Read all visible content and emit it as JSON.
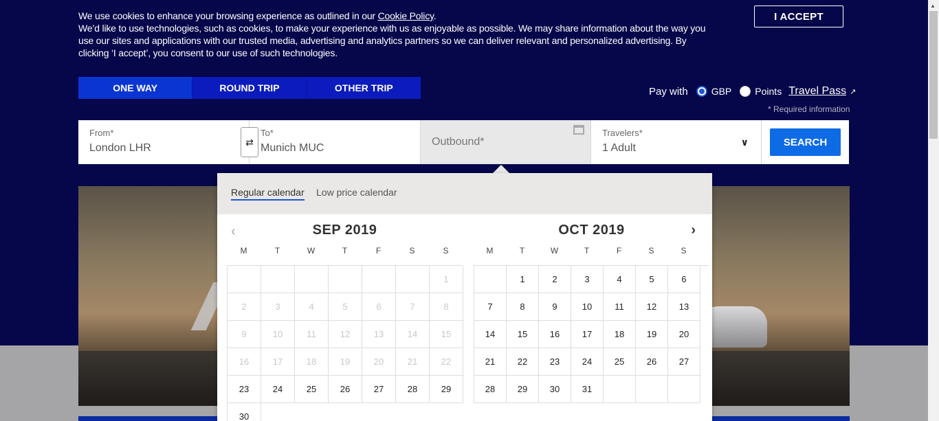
{
  "cookie": {
    "line1": "We use cookies to enhance your browsing experience as outlined in our ",
    "policy_link": "Cookie Policy",
    "line1_end": ".",
    "para2": "We’d like to use technologies, such as cookies, to make your experience with us as enjoyable as possible. We may share information about the way you use our sites and applications with our trusted media, advertising and analytics partners so we can deliver relevant and personalized advertising. By clicking ‘I accept’, you consent to our use of such technologies.",
    "accept_label": "I ACCEPT"
  },
  "trip_tabs": [
    {
      "label": "ONE WAY",
      "active": true
    },
    {
      "label": "ROUND TRIP",
      "active": false
    },
    {
      "label": "OTHER  TRIP",
      "active": false
    }
  ],
  "pay": {
    "label": "Pay with",
    "gbp": "GBP",
    "points": "Points",
    "travel_pass": "Travel Pass",
    "required": "* Required information"
  },
  "search": {
    "from_label": "From*",
    "from_value": "London LHR",
    "to_label": "To*",
    "to_value": "Munich MUC",
    "outbound_placeholder": "Outbound*",
    "travelers_label": "Travelers*",
    "travelers_value": "1 Adult",
    "button": "SEARCH"
  },
  "calendar": {
    "tab_regular": "Regular calendar",
    "tab_low": "Low price calendar",
    "weekdays": [
      "M",
      "T",
      "W",
      "T",
      "F",
      "S",
      "S"
    ],
    "sep": {
      "title": "SEP 2019",
      "cells": [
        "",
        "",
        "",
        "",
        "",
        "",
        "1",
        "2",
        "3",
        "4",
        "5",
        "6",
        "7",
        "8",
        "9",
        "10",
        "11",
        "12",
        "13",
        "14",
        "15",
        "16",
        "17",
        "18",
        "19",
        "20",
        "21",
        "22",
        "23",
        "24",
        "25",
        "26",
        "27",
        "28",
        "29",
        "30"
      ],
      "disabled_until": 23
    },
    "oct": {
      "title": "OCT 2019",
      "cells": [
        "",
        "1",
        "2",
        "3",
        "4",
        "5",
        "6",
        "7",
        "8",
        "9",
        "10",
        "11",
        "12",
        "13",
        "14",
        "15",
        "16",
        "17",
        "18",
        "19",
        "20",
        "21",
        "22",
        "23",
        "24",
        "25",
        "26",
        "27",
        "28",
        "29",
        "30",
        "31",
        "",
        "",
        ""
      ]
    }
  }
}
